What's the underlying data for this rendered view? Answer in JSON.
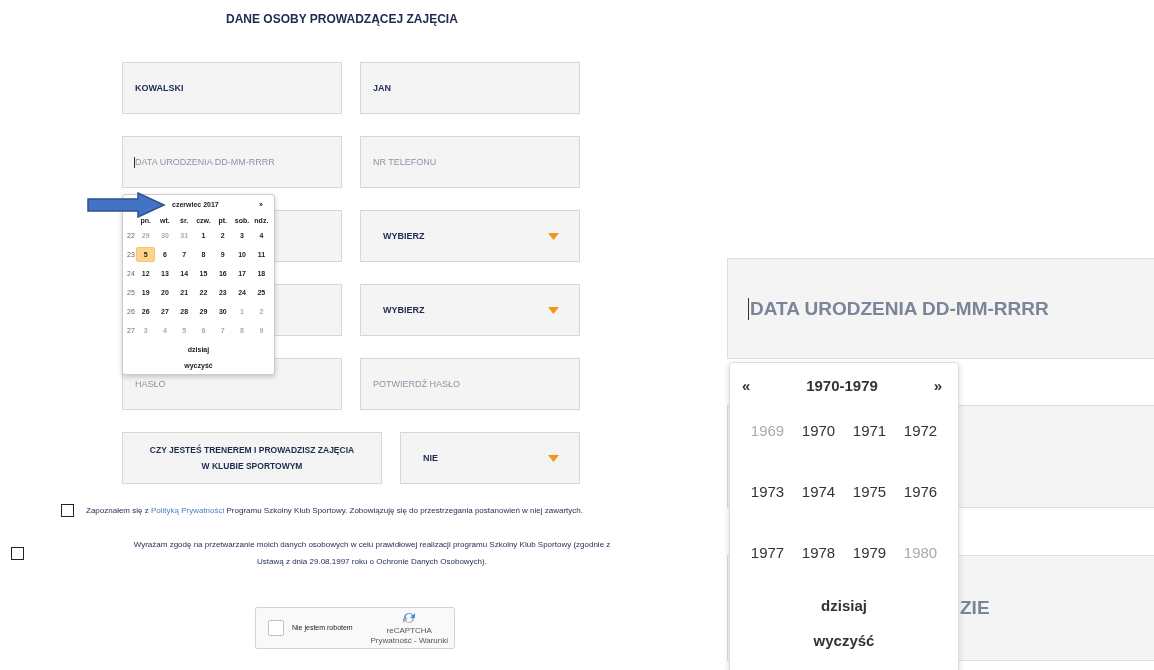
{
  "title": "DANE OSOBY PROWADZĄCEJ ZAJĘCIA",
  "rows": [
    {
      "fields": [
        {
          "kind": "text",
          "value": "KOWALSKI"
        },
        {
          "kind": "text",
          "value": "JAN"
        }
      ]
    },
    {
      "fields": [
        {
          "kind": "text",
          "placeholder": "DATA URODZENIA DD-MM-RRRR",
          "focused": true
        },
        {
          "kind": "text",
          "placeholder": "NR TELEFONU"
        }
      ]
    },
    {
      "fields": [
        {
          "kind": "text"
        },
        {
          "kind": "select",
          "value": "WYBIERZ"
        }
      ]
    },
    {
      "fields": [
        {
          "kind": "text"
        },
        {
          "kind": "select",
          "value": "WYBIERZ"
        }
      ]
    },
    {
      "fields": [
        {
          "kind": "text",
          "placeholder": "HASŁO"
        },
        {
          "kind": "text",
          "placeholder": "POTWIERDŹ HASŁO"
        }
      ]
    },
    {
      "fields": [
        {
          "kind": "question",
          "lines": [
            "CZY JESTEŚ TRENEREM I PROWADZISZ ZAJĘCIA",
            "W KLUBIE SPORTOWYM"
          ]
        },
        {
          "kind": "select",
          "value": "NIE"
        }
      ]
    }
  ],
  "consents": [
    {
      "checked": false,
      "before": "Zapoznałem się z ",
      "link": "Polityką Prywatności",
      "after": " Programu Szkolny Klub Sportowy. Zobowiązuję się do przestrzegania postanowień w niej zawartych."
    },
    {
      "checked": false,
      "lines": [
        "Wyrażam zgodę na przetwarzanie moich danych osobowych w celu prawidłowej realizacji programu Szkolny Klub Sportowy (zgodnie z",
        "Ustawą z dnia 29.08.1997 roku o Ochronie Danych Osobowych)."
      ]
    }
  ],
  "captcha": {
    "checked": false,
    "label": "Nie jestem robotem",
    "brand": "reCAPTCHA",
    "terms": "Prywatność - Warunki"
  },
  "calendar": {
    "month": "czerwiec 2017",
    "next": "»",
    "weekdays": [
      "pn.",
      "wt.",
      "śr.",
      "czw.",
      "pt.",
      "sob.",
      "ndz."
    ],
    "weeks": [
      {
        "number": "22",
        "days": [
          {
            "label": "29",
            "muted": true,
            "selected": false
          },
          {
            "label": "30",
            "muted": true,
            "selected": false
          },
          {
            "label": "31",
            "muted": true,
            "selected": false
          },
          {
            "label": "1",
            "muted": false,
            "selected": false
          },
          {
            "label": "2",
            "muted": false,
            "selected": false
          },
          {
            "label": "3",
            "muted": false,
            "selected": false
          },
          {
            "label": "4",
            "muted": false,
            "selected": false
          }
        ]
      },
      {
        "number": "23",
        "days": [
          {
            "label": "5",
            "muted": false,
            "selected": true
          },
          {
            "label": "6",
            "muted": false,
            "selected": false
          },
          {
            "label": "7",
            "muted": false,
            "selected": false
          },
          {
            "label": "8",
            "muted": false,
            "selected": false
          },
          {
            "label": "9",
            "muted": false,
            "selected": false
          },
          {
            "label": "10",
            "muted": false,
            "selected": false
          },
          {
            "label": "11",
            "muted": false,
            "selected": false
          }
        ]
      },
      {
        "number": "24",
        "days": [
          {
            "label": "12",
            "muted": false,
            "selected": false
          },
          {
            "label": "13",
            "muted": false,
            "selected": false
          },
          {
            "label": "14",
            "muted": false,
            "selected": false
          },
          {
            "label": "15",
            "muted": false,
            "selected": false
          },
          {
            "label": "16",
            "muted": false,
            "selected": false
          },
          {
            "label": "17",
            "muted": false,
            "selected": false
          },
          {
            "label": "18",
            "muted": false,
            "selected": false
          }
        ]
      },
      {
        "number": "25",
        "days": [
          {
            "label": "19",
            "muted": false,
            "selected": false
          },
          {
            "label": "20",
            "muted": false,
            "selected": false
          },
          {
            "label": "21",
            "muted": false,
            "selected": false
          },
          {
            "label": "22",
            "muted": false,
            "selected": false
          },
          {
            "label": "23",
            "muted": false,
            "selected": false
          },
          {
            "label": "24",
            "muted": false,
            "selected": false
          },
          {
            "label": "25",
            "muted": false,
            "selected": false
          }
        ]
      },
      {
        "number": "26",
        "days": [
          {
            "label": "26",
            "muted": false,
            "selected": false
          },
          {
            "label": "27",
            "muted": false,
            "selected": false
          },
          {
            "label": "28",
            "muted": false,
            "selected": false
          },
          {
            "label": "29",
            "muted": false,
            "selected": false
          },
          {
            "label": "30",
            "muted": false,
            "selected": false
          },
          {
            "label": "1",
            "muted": true,
            "selected": false
          },
          {
            "label": "2",
            "muted": true,
            "selected": false
          }
        ]
      },
      {
        "number": "27",
        "days": [
          {
            "label": "3",
            "muted": true,
            "selected": false
          },
          {
            "label": "4",
            "muted": true,
            "selected": false
          },
          {
            "label": "5",
            "muted": true,
            "selected": false
          },
          {
            "label": "6",
            "muted": true,
            "selected": false
          },
          {
            "label": "7",
            "muted": true,
            "selected": false
          },
          {
            "label": "8",
            "muted": true,
            "selected": false
          },
          {
            "label": "9",
            "muted": true,
            "selected": false
          }
        ]
      }
    ],
    "today": "dzisiaj",
    "clear": "wyczyść"
  },
  "inset": {
    "focused": true,
    "placeholder": "DATA URODZENIA DD-MM-RRRR",
    "hidden_text": "ZIE",
    "prev": "«",
    "decade": "1970-1979",
    "next": "»",
    "years": [
      {
        "label": "1969",
        "muted": true
      },
      {
        "label": "1970",
        "muted": false
      },
      {
        "label": "1971",
        "muted": false
      },
      {
        "label": "1972",
        "muted": false
      },
      {
        "label": "1973",
        "muted": false
      },
      {
        "label": "1974",
        "muted": false
      },
      {
        "label": "1975",
        "muted": false
      },
      {
        "label": "1976",
        "muted": false
      },
      {
        "label": "1977",
        "muted": false
      },
      {
        "label": "1978",
        "muted": false
      },
      {
        "label": "1979",
        "muted": false
      },
      {
        "label": "1980",
        "muted": true
      }
    ],
    "today": "dzisiaj",
    "clear": "wyczyść"
  }
}
